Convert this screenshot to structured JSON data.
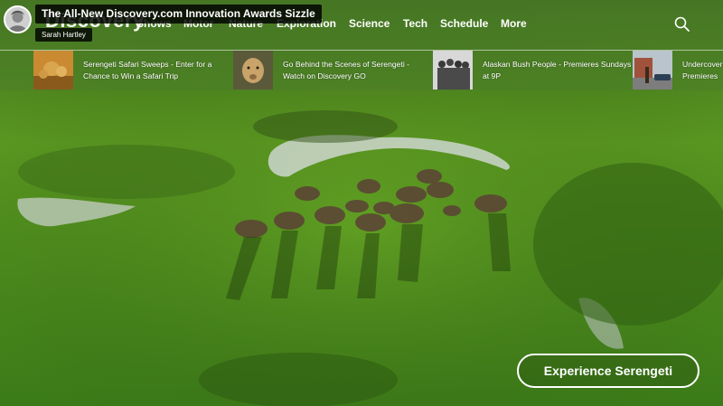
{
  "brand": {
    "logo_text": "Discovery"
  },
  "nav": {
    "items": [
      "Shows",
      "Motor",
      "Nature",
      "Exploration",
      "Science",
      "Tech",
      "Schedule",
      "More"
    ]
  },
  "video": {
    "title": "The All-New Discovery.com Innovation Awards Sizzle",
    "channel": "Sarah Hartley"
  },
  "promos": [
    {
      "text": "Serengeti Safari Sweeps - Enter for a Chance to Win a Safari Trip",
      "thumb": "lion-cubs-thumbnail"
    },
    {
      "text": "Go Behind the Scenes of Serengeti - Watch on Discovery GO",
      "thumb": "lioness-thumbnail"
    },
    {
      "text": "Alaskan Bush People - Premieres Sundays at 9P",
      "thumb": "family-photo-thumbnail"
    },
    {
      "text": "Undercover Premieres",
      "thumb": "street-scene-thumbnail"
    }
  ],
  "cta": {
    "label": "Experience Serengeti"
  },
  "colors": {
    "grass": "#5f9f22",
    "water": "#c9d6cc",
    "text": "#ffffff"
  }
}
